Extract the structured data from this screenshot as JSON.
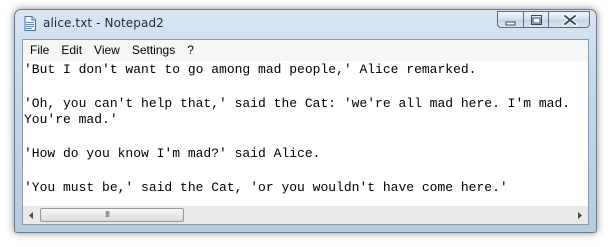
{
  "window": {
    "title": "alice.txt - Notepad2"
  },
  "menu": [
    {
      "label": "File"
    },
    {
      "label": "Edit"
    },
    {
      "label": "View"
    },
    {
      "label": "Settings"
    },
    {
      "label": "?"
    }
  ],
  "editor": {
    "lines": [
      "'But I don't want to go among mad people,' Alice remarked.",
      "",
      "'Oh, you can't help that,' said the Cat: 'we're all mad here. I'm mad.",
      "You're mad.'",
      "",
      "'How do you know I'm mad?' said Alice.",
      "",
      "'You must be,' said the Cat, 'or you wouldn't have come here.'"
    ]
  },
  "scrollbar": {
    "grip": "III"
  },
  "colors": {
    "titlebar": "#c3d6e8",
    "close_button": "#d5e1ee",
    "editor_bg": "#ffffff"
  },
  "icons": [
    "notepad-file-icon",
    "minimize-icon",
    "maximize-icon",
    "close-icon",
    "scroll-left-arrow-icon",
    "scroll-right-arrow-icon"
  ]
}
